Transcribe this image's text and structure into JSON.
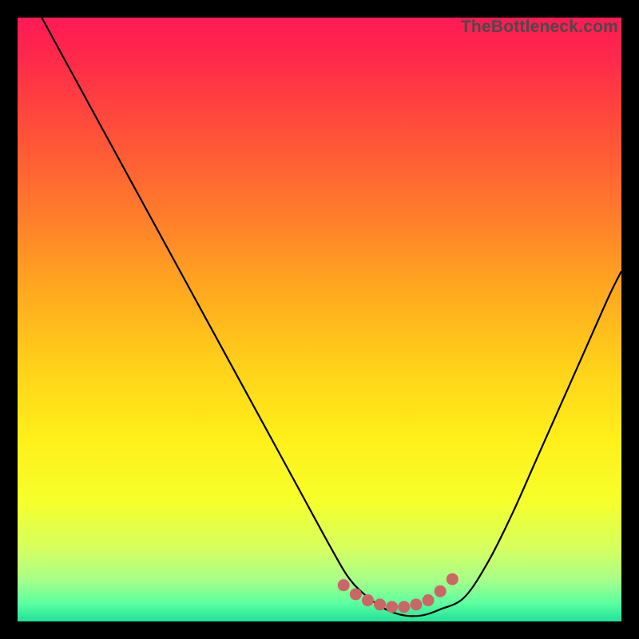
{
  "watermark": "TheBottleneck.com",
  "colors": {
    "frame": "#000000",
    "curve_stroke": "#000000",
    "dots_fill": "#cc6666",
    "gradient_stops": [
      {
        "offset": 0.0,
        "color": "#ff1a55"
      },
      {
        "offset": 0.07,
        "color": "#ff2a4a"
      },
      {
        "offset": 0.18,
        "color": "#ff4d3a"
      },
      {
        "offset": 0.32,
        "color": "#ff7a2c"
      },
      {
        "offset": 0.45,
        "color": "#ffa81f"
      },
      {
        "offset": 0.58,
        "color": "#ffd21a"
      },
      {
        "offset": 0.7,
        "color": "#fff01a"
      },
      {
        "offset": 0.8,
        "color": "#f6ff2a"
      },
      {
        "offset": 0.88,
        "color": "#d6ff60"
      },
      {
        "offset": 0.93,
        "color": "#a8ff88"
      },
      {
        "offset": 0.97,
        "color": "#5cffa0"
      },
      {
        "offset": 1.0,
        "color": "#20e29a"
      }
    ]
  },
  "chart_data": {
    "type": "line",
    "title": "",
    "xlabel": "",
    "ylabel": "",
    "xlim": [
      0,
      100
    ],
    "ylim": [
      0,
      100
    ],
    "series": [
      {
        "name": "bottleneck-curve",
        "x": [
          4,
          10,
          16,
          22,
          28,
          34,
          40,
          46,
          52,
          55,
          58,
          61,
          64,
          67,
          70,
          74,
          78,
          82,
          86,
          90,
          94,
          98,
          100
        ],
        "y": [
          100,
          89,
          78,
          67,
          56,
          45,
          34,
          23,
          12,
          7,
          4,
          2,
          1,
          1,
          2,
          4,
          10,
          18,
          27,
          36,
          45,
          54,
          58
        ]
      }
    ],
    "annotations": {
      "flat_region_dots": {
        "x": [
          54,
          56,
          58,
          60,
          62,
          64,
          66,
          68,
          70,
          72
        ],
        "y": [
          6,
          4.5,
          3.5,
          2.8,
          2.4,
          2.4,
          2.8,
          3.5,
          5,
          7
        ]
      }
    }
  }
}
